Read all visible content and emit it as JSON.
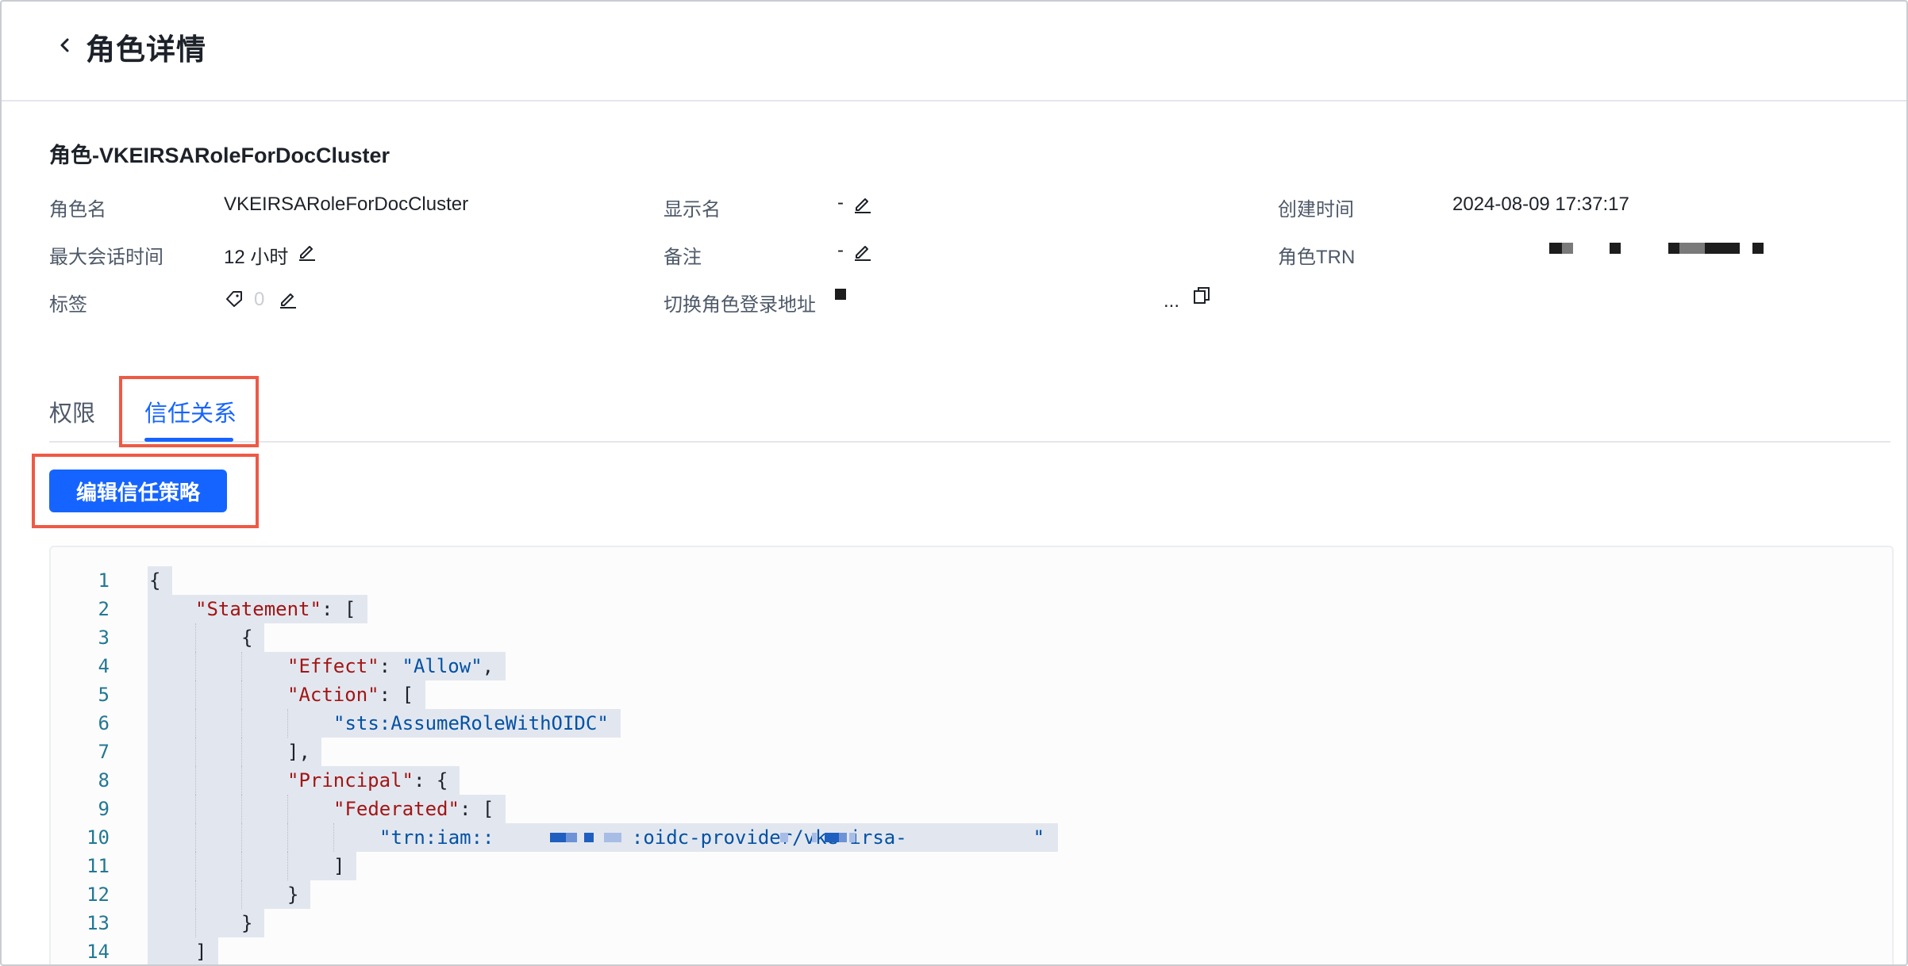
{
  "header": {
    "title": "角色详情"
  },
  "role": {
    "heading": "角色-VKEIRSARoleForDocCluster",
    "fields": {
      "role_name_label": "角色名",
      "role_name_value": "VKEIRSARoleForDocCluster",
      "display_name_label": "显示名",
      "display_name_value": "-",
      "created_label": "创建时间",
      "created_value": "2024-08-09 17:37:17",
      "max_session_label": "最大会话时间",
      "max_session_value": "12 小时",
      "remark_label": "备注",
      "remark_value": "-",
      "trn_label": "角色TRN",
      "tags_label": "标签",
      "tags_count": "0",
      "switch_url_label": "切换角色登录地址",
      "switch_url_ellipsis": "..."
    }
  },
  "tabs": [
    {
      "label": "权限",
      "active": false
    },
    {
      "label": "信任关系",
      "active": true
    }
  ],
  "actions": {
    "edit_trust_policy": "编辑信任策略"
  },
  "colors": {
    "accent": "#1664ff",
    "highlight": "#ee5a45"
  },
  "code": {
    "lines": [
      {
        "n": "1",
        "indent": 0,
        "parts": [
          [
            "p",
            "{"
          ]
        ]
      },
      {
        "n": "2",
        "indent": 1,
        "parts": [
          [
            "k",
            "\"Statement\""
          ],
          [
            "p",
            ": ["
          ]
        ]
      },
      {
        "n": "3",
        "indent": 2,
        "parts": [
          [
            "p",
            "{"
          ]
        ]
      },
      {
        "n": "4",
        "indent": 3,
        "parts": [
          [
            "k",
            "\"Effect\""
          ],
          [
            "p",
            ": "
          ],
          [
            "v",
            "\"Allow\""
          ],
          [
            "p",
            ","
          ]
        ]
      },
      {
        "n": "5",
        "indent": 3,
        "parts": [
          [
            "k",
            "\"Action\""
          ],
          [
            "p",
            ": ["
          ]
        ]
      },
      {
        "n": "6",
        "indent": 4,
        "parts": [
          [
            "v",
            "\"sts:AssumeRoleWithOIDC\""
          ]
        ]
      },
      {
        "n": "7",
        "indent": 3,
        "parts": [
          [
            "p",
            "],"
          ]
        ]
      },
      {
        "n": "8",
        "indent": 3,
        "parts": [
          [
            "k",
            "\"Principal\""
          ],
          [
            "p",
            ": {"
          ]
        ]
      },
      {
        "n": "9",
        "indent": 4,
        "parts": [
          [
            "k",
            "\"Federated\""
          ],
          [
            "p",
            ": ["
          ]
        ]
      },
      {
        "n": "10",
        "indent": 5,
        "parts": [
          [
            "v",
            "\"trn:iam::            :oidc-provider/vke-irsa-           \""
          ]
        ]
      },
      {
        "n": "11",
        "indent": 4,
        "parts": [
          [
            "p",
            "]"
          ]
        ]
      },
      {
        "n": "12",
        "indent": 3,
        "parts": [
          [
            "p",
            "}"
          ]
        ]
      },
      {
        "n": "13",
        "indent": 2,
        "parts": [
          [
            "p",
            "}"
          ]
        ]
      },
      {
        "n": "14",
        "indent": 1,
        "parts": [
          [
            "p",
            "]"
          ]
        ]
      }
    ]
  }
}
